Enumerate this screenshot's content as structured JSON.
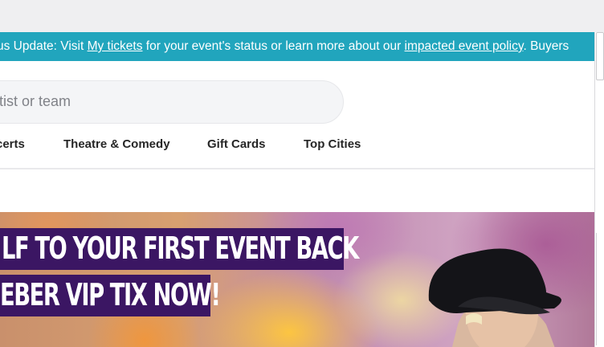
{
  "banner": {
    "lead_text": "us Update: Visit ",
    "link_my_tickets": "My tickets",
    "middle_text": " for your event's status or learn more about our ",
    "link_policy": "impacted event policy",
    "tail_text": ". Buyers"
  },
  "search": {
    "placeholder_visible": "tist or team"
  },
  "nav": {
    "items": [
      "certs",
      "Theatre & Comedy",
      "Gift Cards",
      "Top Cities"
    ]
  },
  "hero": {
    "line1": "LF TO YOUR FIRST EVENT BACK",
    "line2": "EBER VIP TIX NOW!"
  },
  "colors": {
    "banner_bg": "#21a5bd",
    "hero_text_bg": "#3b1663"
  }
}
